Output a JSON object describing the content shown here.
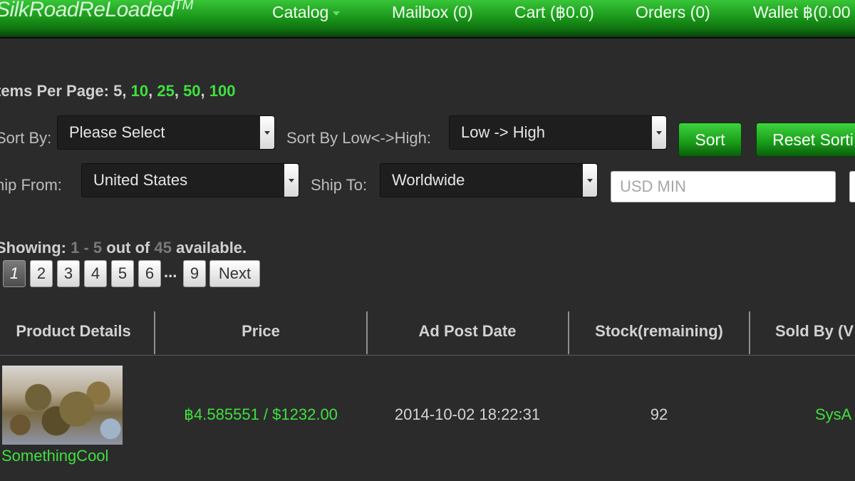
{
  "navbar": {
    "brand": "SilkRoadReLoaded",
    "brand_mark": "TM",
    "catalog": "Catalog",
    "mailbox": "Mailbox (0)",
    "cart": "Cart (฿0.0)",
    "orders": "Orders (0)",
    "wallet": "Wallet ฿(0.00"
  },
  "items_per_page": {
    "label": "tems Per Page:",
    "current": "5",
    "options": [
      "10",
      "25",
      "50",
      "100"
    ]
  },
  "filters": {
    "sort_by_label": "Sort By:",
    "sort_by_value": "Please Select",
    "sort_dir_label": "Sort By Low<->High:",
    "sort_dir_value": "Low -> High",
    "sort_button": "Sort",
    "reset_button": "Reset Sorti",
    "ship_from_label": "hip From:",
    "ship_from_value": "United States",
    "ship_to_label": "Ship To:",
    "ship_to_value": "Worldwide",
    "usd_min_placeholder": "USD MIN"
  },
  "showing": {
    "label": "Showing:",
    "range": "1 - 5",
    "out_of": "out of",
    "total": "45",
    "suffix": "available."
  },
  "pagination": {
    "pages": [
      "1",
      "2",
      "3",
      "4",
      "5",
      "6"
    ],
    "active": "1",
    "ellipsis": "...",
    "last": "9",
    "next": "Next"
  },
  "table": {
    "headers": [
      "Product Details",
      "Price",
      "Ad Post Date",
      "Stock(remaining)",
      "Sold By (V"
    ],
    "rows": [
      {
        "product": "SomethingCool",
        "price": "฿4.585551 / $1232.00",
        "date": "2014-10-02 18:22:31",
        "stock": "92",
        "seller": "SysA"
      }
    ]
  },
  "colors": {
    "accent_green": "#3fe03f",
    "background": "#2b2b2b",
    "nav_green": "#1c9a1c"
  }
}
